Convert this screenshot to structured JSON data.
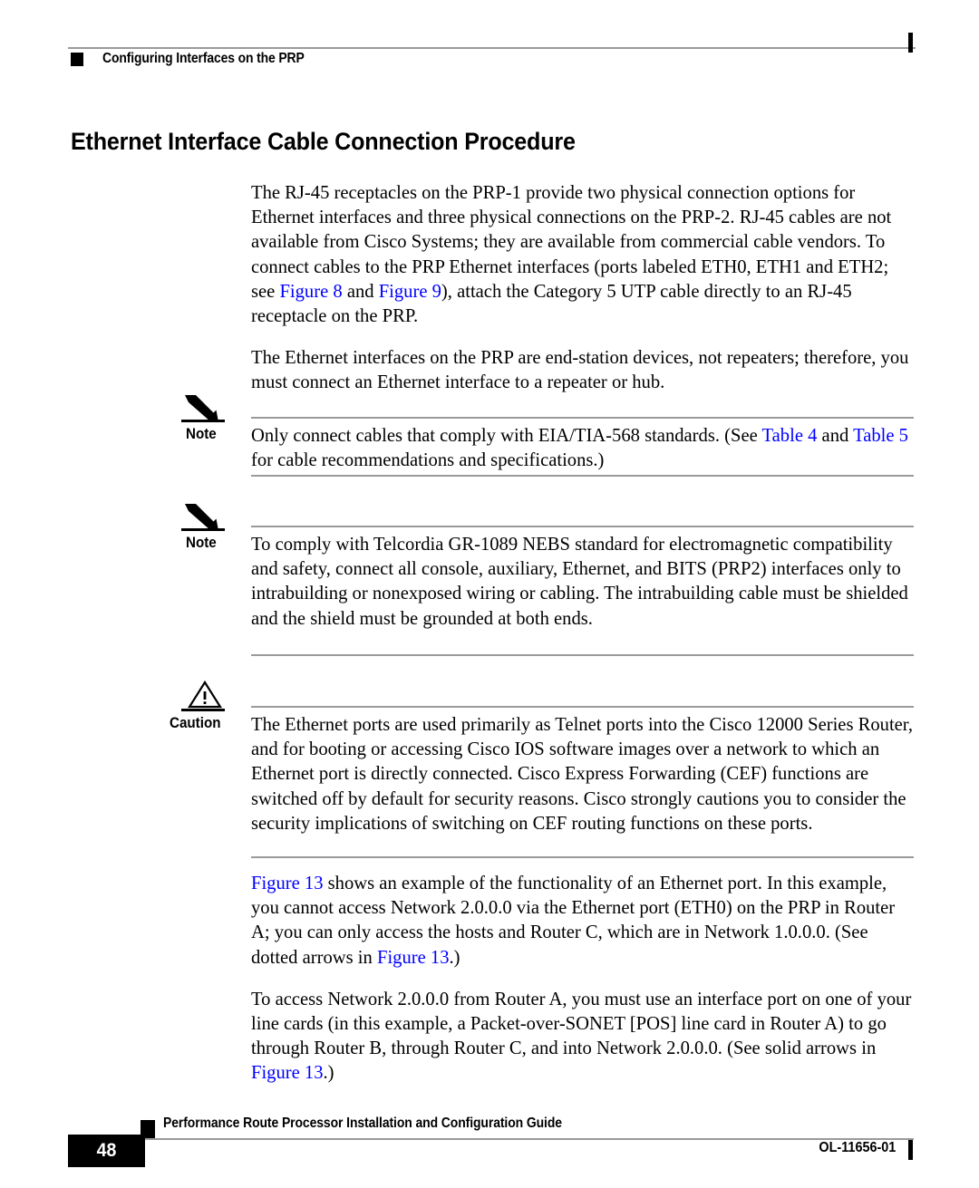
{
  "header": {
    "chapter_title": "Configuring Interfaces on the PRP",
    "marker_icon": "black-square-bullet",
    "change_bar_icon": "vertical-change-bar"
  },
  "section": {
    "title": "Ethernet Interface Cable Connection Procedure"
  },
  "body": {
    "paragraph_1": {
      "part_1": "The RJ-45 receptacles on the PRP-1 provide two physical connection options for Ethernet interfaces and three physical connections on the PRP-2. RJ-45 cables are not available from Cisco Systems; they are available from commercial cable vendors. To connect cables to the PRP Ethernet interfaces (ports labeled ETH0, ETH1 and ETH2; see ",
      "link_1": "Figure 8",
      "part_2": " and ",
      "link_2": "Figure 9",
      "part_3": "), attach the Category 5 UTP cable directly to an RJ-45 receptacle on the PRP."
    },
    "paragraph_2": {
      "text": "The Ethernet interfaces on the PRP are end-station devices, not repeaters; therefore, you must connect an Ethernet interface to a repeater or hub."
    },
    "paragraph_3": {
      "link_1": "Figure 13",
      "part_1": " shows an example of the functionality of an Ethernet port. In this example, you cannot access Network 2.0.0.0 via the Ethernet port (ETH0) on the PRP in Router A; you can only access the hosts and Router C, which are in Network 1.0.0.0. (See dotted arrows in ",
      "link_2": "Figure 13",
      "part_2": ".)"
    },
    "paragraph_4": {
      "part_1": "To access Network 2.0.0.0 from Router A, you must use an interface port on one of your line cards (in this example, a Packet-over-SONET [POS] line card in Router A) to go through Router B, through Router C, and into Network 2.0.0.0. (See solid arrows in ",
      "link_1": "Figure 13",
      "part_2": ".)"
    }
  },
  "admonitions": [
    {
      "type": "note",
      "label": "Note",
      "icon": "pencil-icon",
      "part_1": "Only connect cables that comply with EIA/TIA-568 standards. (See ",
      "link_1": "Table 4",
      "part_2": " and ",
      "link_2": "Table 5",
      "part_3": " for cable recommendations and specifications.)"
    },
    {
      "type": "note",
      "label": "Note",
      "icon": "pencil-icon",
      "text": "To comply with Telcordia GR-1089 NEBS standard for electromagnetic compatibility and safety, connect all console, auxiliary, Ethernet, and BITS (PRP2) interfaces only to intrabuilding or nonexposed wiring or cabling. The intrabuilding cable must be shielded and the shield must be grounded at both ends."
    },
    {
      "type": "caution",
      "label": "Caution",
      "icon": "warning-triangle-icon",
      "text": "The Ethernet ports are used primarily as Telnet ports into the Cisco 12000 Series Router, and for booting or accessing Cisco IOS software images over a network to which an Ethernet port is directly connected. Cisco Express Forwarding (CEF) functions are switched off by default for security reasons. Cisco strongly cautions you to consider the security implications of switching on CEF routing functions on these ports."
    }
  ],
  "footer": {
    "page_number": "48",
    "guide_title": "Performance Route Processor Installation and Configuration Guide",
    "document_id": "OL-11656-01",
    "marker_icon": "black-square-bullet",
    "change_bar_icon": "vertical-change-bar"
  },
  "colors": {
    "link": "#0000ff",
    "rule": "#9a9a9a",
    "text": "#000000"
  }
}
